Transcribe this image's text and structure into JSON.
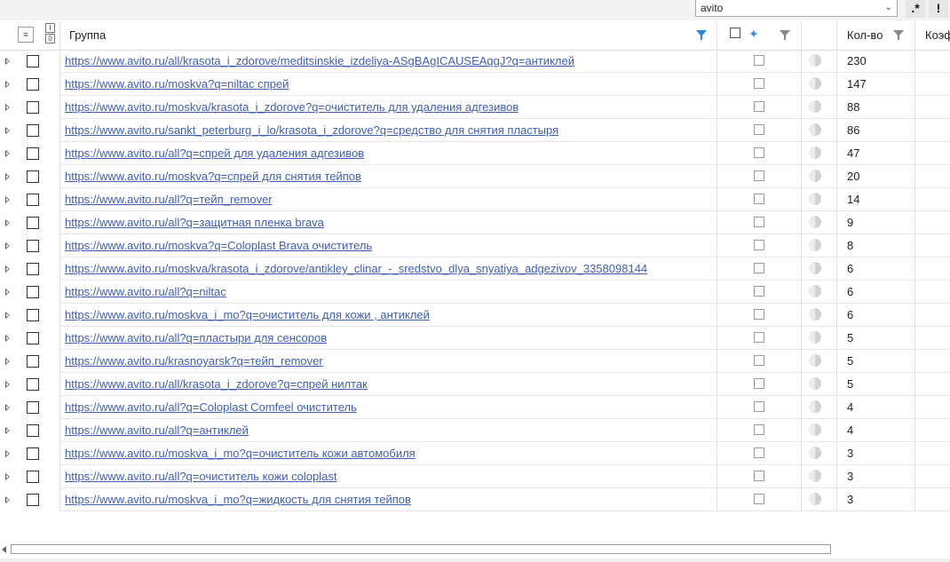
{
  "filter": {
    "value": "avito",
    "regex_label": ".*",
    "exclude_label": "!"
  },
  "header": {
    "group_label": "Группа",
    "count_label": "Кол-во",
    "coef_label": "Коэф",
    "io_top": "I",
    "io_bottom": "0"
  },
  "rows": [
    {
      "url": "https://www.avito.ru/all/krasota_i_zdorove/meditsinskie_izdeliya-ASgBAgICAUSEAqgJ?q=антиклей",
      "count": "230"
    },
    {
      "url": "https://www.avito.ru/moskva?q=niltac спрей",
      "count": "147"
    },
    {
      "url": "https://www.avito.ru/moskva/krasota_i_zdorove?q=очиститель для удаления адгезивов",
      "count": "88"
    },
    {
      "url": "https://www.avito.ru/sankt_peterburg_i_lo/krasota_i_zdorove?q=средство для снятия пластыря",
      "count": "86"
    },
    {
      "url": "https://www.avito.ru/all?q=спрей для удаления адгезивов",
      "count": "47"
    },
    {
      "url": "https://www.avito.ru/moskva?q=спрей для снятия тейпов",
      "count": "20"
    },
    {
      "url": "https://www.avito.ru/all?q=тейп_remover",
      "count": "14"
    },
    {
      "url": "https://www.avito.ru/all?q=защитная пленка brava",
      "count": "9"
    },
    {
      "url": "https://www.avito.ru/moskva?q=Coloplast Brava очиститель",
      "count": "8"
    },
    {
      "url": "https://www.avito.ru/moskva/krasota_i_zdorove/antikley_clinar_-_sredstvo_dlya_snyatiya_adgezivov_3358098144",
      "count": "6"
    },
    {
      "url": "https://www.avito.ru/all?q=niltac",
      "count": "6"
    },
    {
      "url": "https://www.avito.ru/moskva_i_mo?q=очиститель для кожи , антиклей",
      "count": "6"
    },
    {
      "url": "https://www.avito.ru/all?q=пластыри для сенсоров",
      "count": "5"
    },
    {
      "url": "https://www.avito.ru/krasnoyarsk?q=тейп_remover",
      "count": "5"
    },
    {
      "url": "https://www.avito.ru/all/krasota_i_zdorove?q=спрей нилтак",
      "count": "5"
    },
    {
      "url": "https://www.avito.ru/all?q=Coloplast Comfeel очиститель",
      "count": "4"
    },
    {
      "url": "https://www.avito.ru/all?q=антиклей",
      "count": "4"
    },
    {
      "url": "https://www.avito.ru/moskva_i_mo?q=очиститель кожи автомобиля",
      "count": "3"
    },
    {
      "url": "https://www.avito.ru/all?q=очиститель кожи coloplast",
      "count": "3"
    },
    {
      "url": "https://www.avito.ru/moskva_i_mo?q=жидкость для снятия тейпов",
      "count": "3"
    }
  ],
  "colors": {
    "link": "#3f5fb0",
    "filter_active": "#2a86d8"
  }
}
